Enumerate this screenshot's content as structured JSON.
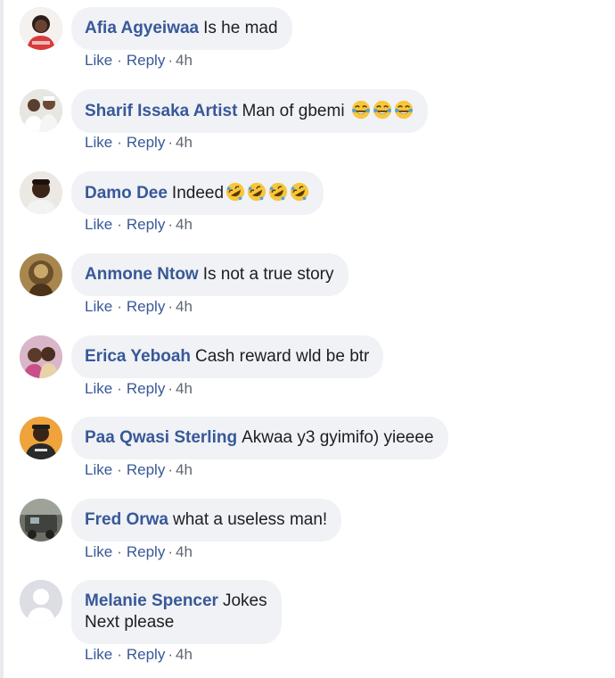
{
  "comments": [
    {
      "author": "Afia Agyeiwaa",
      "text": "Is he mad",
      "emojis": [],
      "like": "Like",
      "reply": "Reply",
      "dot": "·",
      "time": "4h",
      "avatar": "avatar-afia"
    },
    {
      "author": "Sharif Issaka Artist",
      "text": "Man of gbemi ",
      "emojis": [
        "tears-of-joy-emoji",
        "tears-of-joy-emoji",
        "tears-of-joy-emoji"
      ],
      "like": "Like",
      "reply": "Reply",
      "dot": "·",
      "time": "4h",
      "avatar": "avatar-sharif"
    },
    {
      "author": "Damo Dee",
      "text": "Indeed",
      "emojis": [
        "rolling-laughing-emoji",
        "rolling-laughing-emoji",
        "rolling-laughing-emoji",
        "rolling-laughing-emoji"
      ],
      "like": "Like",
      "reply": "Reply",
      "dot": "·",
      "time": "4h",
      "avatar": "avatar-damo"
    },
    {
      "author": "Anmone Ntow",
      "text": "Is not a true story",
      "emojis": [],
      "like": "Like",
      "reply": "Reply",
      "dot": "·",
      "time": "4h",
      "avatar": "avatar-anmone"
    },
    {
      "author": "Erica Yeboah",
      "text": "Cash reward wld be btr",
      "emojis": [],
      "like": "Like",
      "reply": "Reply",
      "dot": "·",
      "time": "4h",
      "avatar": "avatar-erica"
    },
    {
      "author": "Paa Qwasi Sterling",
      "text": "Akwaa y3 gyimifo) yieeee",
      "emojis": [],
      "like": "Like",
      "reply": "Reply",
      "dot": "·",
      "time": "4h",
      "avatar": "avatar-paa"
    },
    {
      "author": "Fred Orwa",
      "text": "what a useless man!",
      "emojis": [],
      "like": "Like",
      "reply": "Reply",
      "dot": "·",
      "time": "4h",
      "avatar": "avatar-fred"
    },
    {
      "author": "Melanie Spencer",
      "text": "Jokes",
      "text2": "Next please",
      "emojis": [],
      "like": "Like",
      "reply": "Reply",
      "dot": "·",
      "time": "4h",
      "avatar": "default-avatar"
    }
  ],
  "colors": {
    "bubble": "#f0f2f5",
    "author": "#385898",
    "meta": "#606770"
  }
}
